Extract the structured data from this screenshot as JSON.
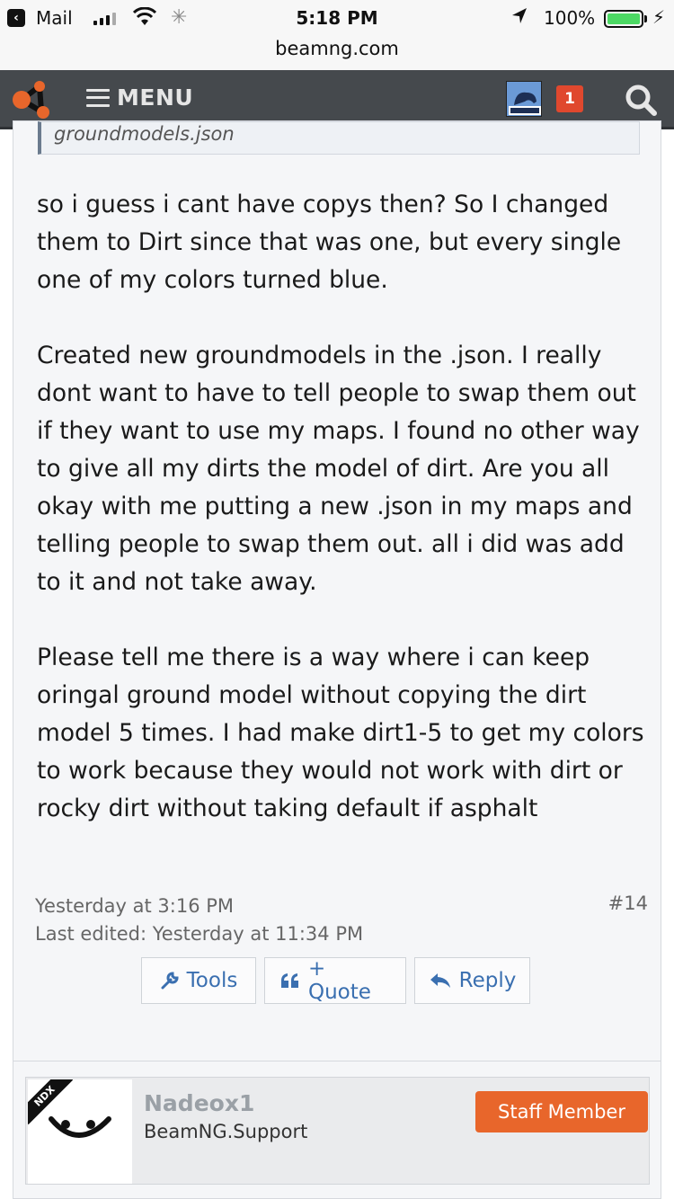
{
  "status_bar": {
    "back_app": "Mail",
    "time": "5:18 PM",
    "battery": "100%"
  },
  "url": "beamng.com",
  "nav": {
    "menu_label": "MENU",
    "notification_count": "1"
  },
  "post": {
    "quote_text": "groundmodels.json",
    "paragraphs": [
      "so i guess i cant have copys then? So I changed them to Dirt since that was one, but every single one of my colors turned blue.",
      "Created new groundmodels in the .json. I really dont want to have to tell people to swap them out if they want to use my maps. I found no other way to give all my dirts the model of dirt. Are you all okay with me putting a new .json in my maps and telling people to swap them out. all i did was add to it and not take away.",
      "Please tell me there is a way where i can keep oringal ground model without copying the dirt model 5 times. I had make dirt1-5 to get my colors to work because they would not work with dirt or rocky dirt without taking default if asphalt"
    ],
    "posted_at": "Yesterday at 3:16 PM",
    "edited_at": "Last edited: Yesterday at 11:34 PM",
    "post_number": "#14",
    "actions": {
      "tools": "Tools",
      "quote": "+ Quote",
      "reply": "Reply"
    }
  },
  "next_post": {
    "avatar_tag": "NDX",
    "username": "Nadeox1",
    "user_title": "BeamNG.Support",
    "badge": "Staff Member"
  },
  "colors": {
    "nav_bg": "#45494d",
    "accent_orange": "#e8662b",
    "badge_red": "#e0482e",
    "link_blue": "#3a6fb0"
  }
}
